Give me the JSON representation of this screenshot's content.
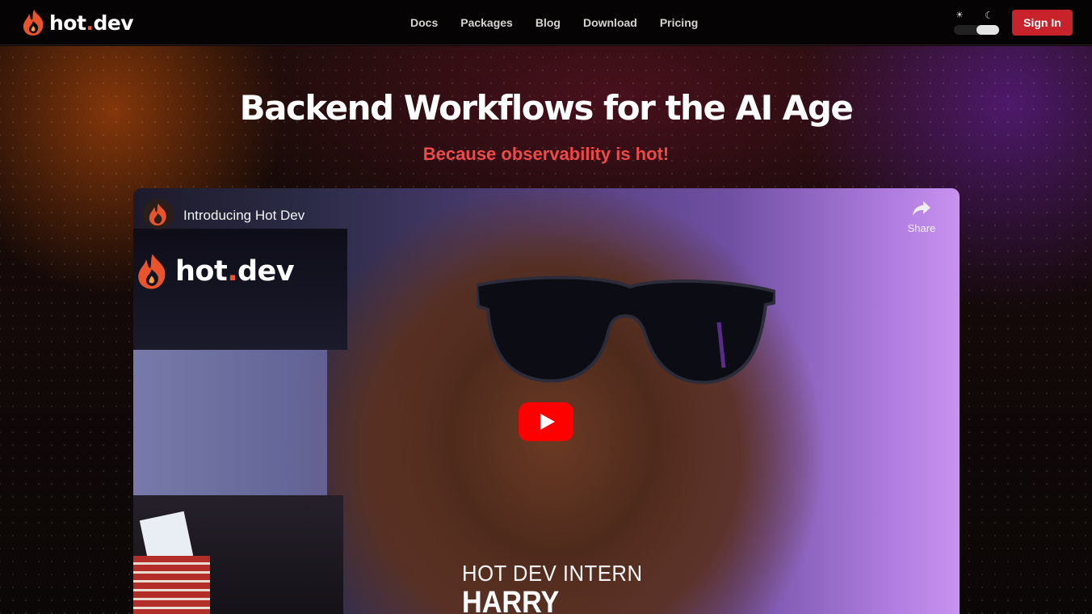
{
  "header": {
    "brand": {
      "name_main": "hot",
      "name_dot": ".",
      "name_tld": "dev"
    },
    "nav": [
      {
        "label": "Docs"
      },
      {
        "label": "Packages"
      },
      {
        "label": "Blog"
      },
      {
        "label": "Download"
      },
      {
        "label": "Pricing"
      }
    ],
    "theme_toggle": {
      "sun_icon": "☀",
      "moon_icon": "☾",
      "mode": "dark"
    },
    "sign_in_label": "Sign In"
  },
  "hero": {
    "title": "Backend Workflows for the AI Age",
    "subtitle": "Because observability is hot!"
  },
  "video": {
    "title": "Introducing Hot Dev",
    "share_label": "Share",
    "overlay_logo": {
      "name_main": "hot",
      "name_dot": ".",
      "name_tld": "dev"
    },
    "caption_role": "HOT DEV INTERN",
    "caption_name": "HARRY"
  },
  "colors": {
    "accent": "#e8542b",
    "sign_in_bg": "#c8232b",
    "subtitle": "#ef4a4a",
    "play_button": "#ff0000"
  }
}
